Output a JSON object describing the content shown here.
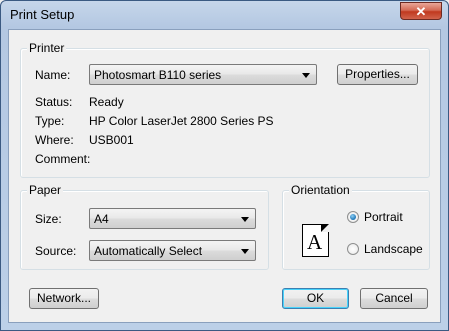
{
  "window": {
    "title": "Print Setup",
    "close_glyph": "✕"
  },
  "printer": {
    "legend": "Printer",
    "name_label": "Name:",
    "name_value": "Photosmart B110 series",
    "properties_button": "Properties...",
    "status_label": "Status:",
    "status_value": "Ready",
    "type_label": "Type:",
    "type_value": "HP Color LaserJet 2800 Series PS",
    "where_label": "Where:",
    "where_value": "USB001",
    "comment_label": "Comment:",
    "comment_value": ""
  },
  "paper": {
    "legend": "Paper",
    "size_label": "Size:",
    "size_value": "A4",
    "source_label": "Source:",
    "source_value": "Automatically Select"
  },
  "orientation": {
    "legend": "Orientation",
    "page_letter": "A",
    "portrait_label": "Portrait",
    "landscape_label": "Landscape",
    "selected": "Portrait"
  },
  "buttons": {
    "network": "Network...",
    "ok": "OK",
    "cancel": "Cancel"
  }
}
